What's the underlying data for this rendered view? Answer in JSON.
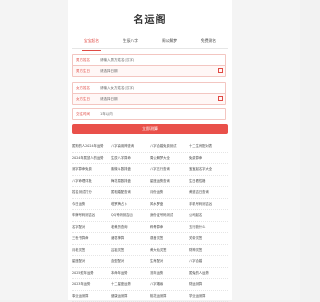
{
  "app": {
    "title": "名运阁"
  },
  "tabs": [
    {
      "label": "宝宝起名"
    },
    {
      "label": "生辰八字"
    },
    {
      "label": "周公解梦"
    },
    {
      "label": "免费测名"
    }
  ],
  "form": {
    "fields": [
      {
        "label": "男方姓名",
        "placeholder": "请输入男方姓名(汉字)"
      },
      {
        "label": "男方生日",
        "placeholder": "请选择日期"
      },
      {
        "label": "女方姓名",
        "placeholder": "请输入女方姓名(汉字)"
      },
      {
        "label": "女方生日",
        "placeholder": "请选择日期"
      },
      {
        "label": "交往时间",
        "value": "1年以内"
      }
    ],
    "submit_label": "立即测算"
  },
  "colors": {
    "accent": "#e04a44",
    "button": "#e9504a"
  },
  "list": [
    [
      "属狗的人2024年运势",
      "八字喜用神查询",
      "八字合婚免费测试",
      "十二生肖配对表"
    ],
    [
      "2024年属鼠人的运势",
      "生辰八字算命",
      "周公解梦大全",
      "免费算命"
    ],
    [
      "测字算命免费",
      "紫微斗数排盘",
      "八字五行查询",
      "宝宝起名字大全"
    ],
    [
      "八字命理详批",
      "梅花易数排盘",
      "星座运势查询",
      "生日看性格"
    ],
    [
      "姓名测试打分",
      "属相婚配查询",
      "月份运势",
      "黄道吉日查询"
    ],
    [
      "今日运势",
      "塔罗牌占卜",
      "风水罗盘",
      "手机号码测吉凶"
    ],
    [
      "车牌号码测吉凶",
      "QQ号码测吉凶",
      "身份证号码测试",
      "公司起名"
    ],
    [
      "名字配对",
      "老黄历查询",
      "称骨算命",
      "五行缺什么"
    ],
    [
      "三世书算命",
      "诸葛神算",
      "观音灵签",
      "关帝灵签"
    ],
    [
      "月老灵签",
      "吕祖灵签",
      "黄大仙灵签",
      "财神灵签"
    ],
    [
      "星座配对",
      "血型配对",
      "生肖配对",
      "八字合婚"
    ],
    [
      "2025蛇年运势",
      "本命年运势",
      "流年运势",
      "属兔的人运势"
    ],
    [
      "2023年运势",
      "十二星座运势",
      "八字姻缘",
      "财运测算"
    ],
    [
      "事业运测算",
      "健康运测算",
      "桃花运测算",
      "学业运测算"
    ]
  ]
}
